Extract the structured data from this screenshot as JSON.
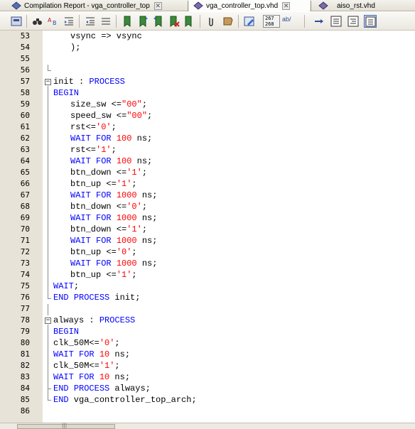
{
  "tabs": [
    {
      "label": "Compilation Report - vga_controller_top",
      "active": false
    },
    {
      "label": "vga_controller_top.vhd",
      "active": true
    },
    {
      "label": "aiso_rst.vhd",
      "active": false
    }
  ],
  "toolbar": {
    "line_counter": "267\n268",
    "ab_label": "ab/"
  },
  "editor": {
    "lines": [
      {
        "n": "53",
        "code": "vsync => vsync"
      },
      {
        "n": "54",
        "code": ");"
      },
      {
        "n": "55",
        "code": ""
      },
      {
        "n": "56",
        "code": ""
      },
      {
        "n": "57",
        "code": "init : PROCESS"
      },
      {
        "n": "58",
        "code": "BEGIN"
      },
      {
        "n": "59",
        "code": "size_sw <=\"00\";"
      },
      {
        "n": "60",
        "code": "speed_sw <=\"00\";"
      },
      {
        "n": "61",
        "code": "rst<='0';"
      },
      {
        "n": "62",
        "code": "WAIT FOR 100 ns;"
      },
      {
        "n": "63",
        "code": "rst<='1';"
      },
      {
        "n": "64",
        "code": "WAIT FOR 100 ns;"
      },
      {
        "n": "65",
        "code": "btn_down <='1';"
      },
      {
        "n": "66",
        "code": "btn_up <='1';"
      },
      {
        "n": "67",
        "code": "WAIT FOR 1000 ns;"
      },
      {
        "n": "68",
        "code": "btn_down <='0';"
      },
      {
        "n": "69",
        "code": "WAIT FOR 1000 ns;"
      },
      {
        "n": "70",
        "code": "btn_down <='1';"
      },
      {
        "n": "71",
        "code": "WAIT FOR 1000 ns;"
      },
      {
        "n": "72",
        "code": "btn_up <='0';"
      },
      {
        "n": "73",
        "code": "WAIT FOR 1000 ns;"
      },
      {
        "n": "74",
        "code": "btn_up <='1';"
      },
      {
        "n": "75",
        "code": "WAIT;"
      },
      {
        "n": "76",
        "code": "END PROCESS init;"
      },
      {
        "n": "77",
        "code": ""
      },
      {
        "n": "78",
        "code": "always : PROCESS"
      },
      {
        "n": "79",
        "code": "BEGIN"
      },
      {
        "n": "80",
        "code": "clk_50M<='0';"
      },
      {
        "n": "81",
        "code": "WAIT FOR 10 ns;"
      },
      {
        "n": "82",
        "code": "clk_50M<='1';"
      },
      {
        "n": "83",
        "code": "WAIT FOR 10 ns;"
      },
      {
        "n": "84",
        "code": "END PROCESS always;"
      },
      {
        "n": "85",
        "code": "END vga_controller_top_arch;"
      },
      {
        "n": "86",
        "code": ""
      }
    ]
  },
  "colors": {
    "keyword": "#0000ff",
    "literal": "#ff0000",
    "gutter": "#e7e3d8"
  }
}
